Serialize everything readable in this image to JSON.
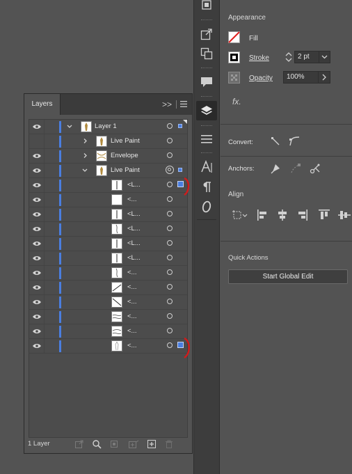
{
  "layers_panel": {
    "tab_label": "Layers",
    "expand_icon": "double-chevron-right-icon",
    "menu_icon": "hamburger-menu-icon",
    "footer_count": "1 Layer",
    "rows": [
      {
        "name": "Layer 1",
        "visible": true,
        "expander": "chevron-down",
        "thumb": "figure",
        "target": "single",
        "selected": "small",
        "corner": true
      },
      {
        "name": "Live Paint",
        "visible": false,
        "expander": "chevron-right",
        "thumb": "figure",
        "target": "single",
        "selected": "none"
      },
      {
        "name": "Envelope",
        "visible": true,
        "expander": "chevron-right",
        "thumb": "envelope",
        "target": "single",
        "selected": "none"
      },
      {
        "name": "Live Paint",
        "visible": true,
        "expander": "chevron-down",
        "thumb": "figure",
        "target": "double",
        "selected": "small"
      },
      {
        "name": "<L...",
        "visible": true,
        "thumb": "line-vertical",
        "target": "single",
        "selected": "big"
      },
      {
        "name": "<...",
        "visible": true,
        "thumb": "blank",
        "target": "single",
        "selected": "none"
      },
      {
        "name": "<L...",
        "visible": true,
        "thumb": "line-vertical",
        "target": "single",
        "selected": "none"
      },
      {
        "name": "<L...",
        "visible": true,
        "thumb": "line-curve",
        "target": "single",
        "selected": "none"
      },
      {
        "name": "<L...",
        "visible": true,
        "thumb": "line-vertical",
        "target": "single",
        "selected": "none"
      },
      {
        "name": "<L...",
        "visible": true,
        "thumb": "line-vertical",
        "target": "single",
        "selected": "none"
      },
      {
        "name": "<...",
        "visible": true,
        "thumb": "line-curve",
        "target": "single",
        "selected": "none"
      },
      {
        "name": "<...",
        "visible": true,
        "thumb": "diagonal-up",
        "target": "single",
        "selected": "none"
      },
      {
        "name": "<...",
        "visible": true,
        "thumb": "diagonal-down",
        "target": "single",
        "selected": "none"
      },
      {
        "name": "<...",
        "visible": true,
        "thumb": "waves",
        "target": "single",
        "selected": "none"
      },
      {
        "name": "<...",
        "visible": true,
        "thumb": "waves2",
        "target": "single",
        "selected": "none"
      },
      {
        "name": "<...",
        "visible": true,
        "thumb": "figure-outline",
        "target": "single",
        "selected": "big"
      }
    ],
    "footer_icons": [
      "export-icon",
      "search-icon",
      "clipping-mask-icon",
      "sublayer-icon",
      "new-layer-icon",
      "trash-icon"
    ]
  },
  "tool_strip": {
    "icons": [
      "artboard-export-icon",
      "external-link-icon",
      "copy-icon",
      "comment-icon",
      "layers-icon",
      "align-lines-icon",
      "character-icon",
      "paragraph-icon",
      "opentype-icon"
    ]
  },
  "properties": {
    "appearance_title": "Appearance",
    "fill_label": "Fill",
    "stroke_label": "Stroke",
    "stroke_value": "2 pt",
    "opacity_label": "Opacity",
    "opacity_value": "100%",
    "fx_label": "fx.",
    "convert_label": "Convert:",
    "anchors_label": "Anchors:",
    "align_title": "Align",
    "quick_actions_title": "Quick Actions",
    "start_global_edit": "Start Global Edit"
  },
  "colors": {
    "selection_blue": "#4a7ee0",
    "annotation_red": "#d21b1b",
    "fill_none_red": "#e0201f"
  }
}
